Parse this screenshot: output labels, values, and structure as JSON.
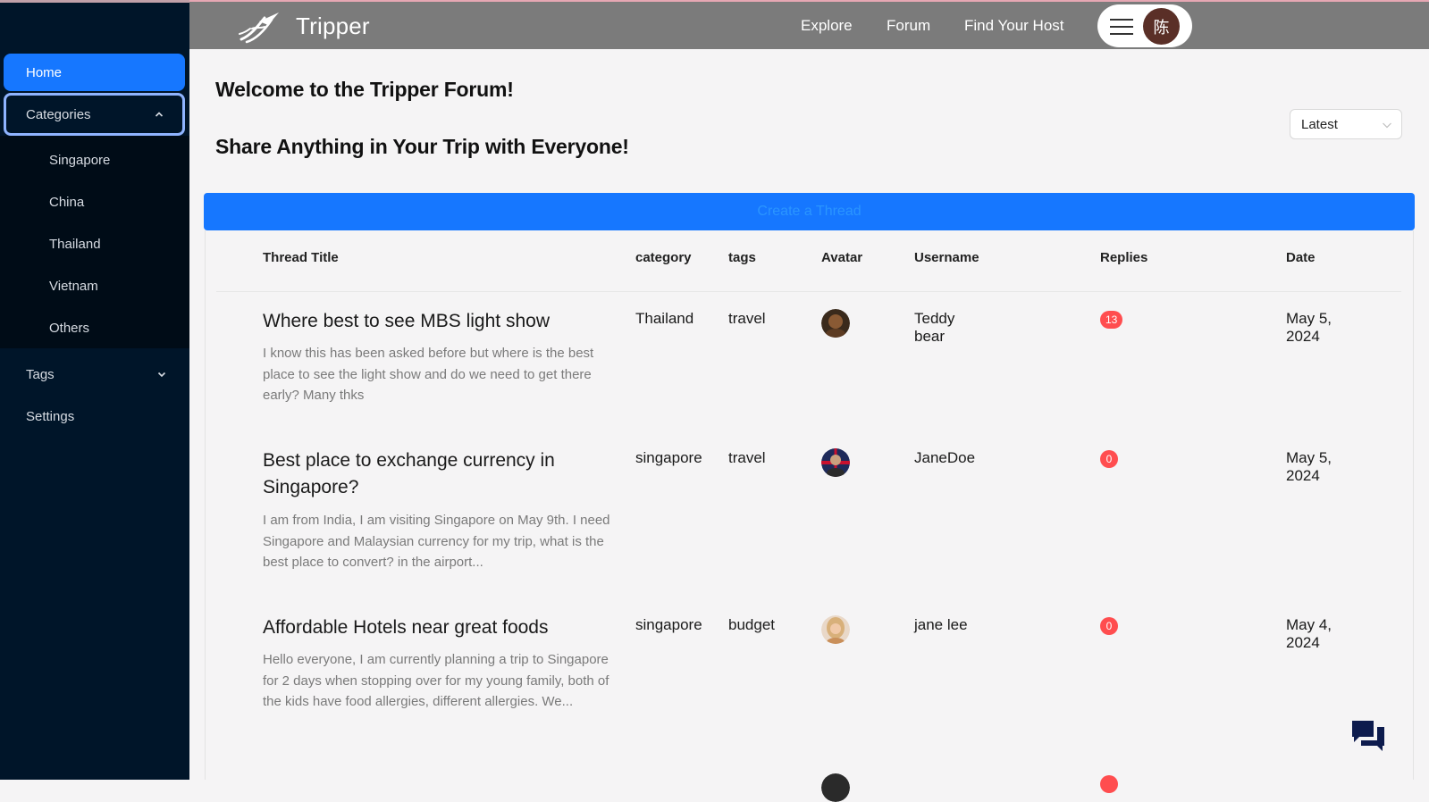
{
  "app": {
    "brand": "Tripper"
  },
  "topnav": {
    "links": [
      "Explore",
      "Forum",
      "Find Your Host"
    ],
    "user_initial": "陈"
  },
  "sidebar": {
    "home": "Home",
    "categories": "Categories",
    "category_items": [
      "Singapore",
      "China",
      "Thailand",
      "Vietnam",
      "Others"
    ],
    "tags": "Tags",
    "settings": "Settings"
  },
  "main": {
    "welcome": "Welcome to the Tripper Forum!",
    "share": "Share Anything in Your Trip with Everyone!",
    "sort": {
      "selected": "Latest"
    },
    "create_thread": "Create a Thread"
  },
  "table": {
    "headers": {
      "title": "Thread Title",
      "category": "category",
      "tags": "tags",
      "avatar": "Avatar",
      "username": "Username",
      "replies": "Replies",
      "date": "Date"
    },
    "rows": [
      {
        "title": "Where best to see MBS light show",
        "excerpt": "I know this has been asked before but where is the best place to see the light show and do we need to get there early? Many thks",
        "category": "Thailand",
        "tag": "travel",
        "username": "Teddy bear",
        "replies": "13",
        "date": "May 5, 2024"
      },
      {
        "title": "Best place to exchange currency in Singapore?",
        "excerpt": "I am from India, I am visiting Singapore on May 9th. I need Singapore and Malaysian currency for my trip, what is the best place to convert? in the airport...",
        "category": "singapore",
        "tag": "travel",
        "username": "JaneDoe",
        "replies": "0",
        "date": "May 5, 2024"
      },
      {
        "title": "Affordable Hotels near great foods",
        "excerpt": "Hello everyone, I am currently planning a trip to Singapore for 2 days when stopping over for my young family, both of the kids have food allergies, different allergies. We...",
        "category": "singapore",
        "tag": "budget",
        "username": "jane lee",
        "replies": "0",
        "date": "May 4, 2024"
      }
    ]
  },
  "colors": {
    "sidebar_bg": "#001529",
    "accent": "#1677ff",
    "topbar_bg": "#7b7b7b",
    "badge": "#ff4d4f"
  }
}
